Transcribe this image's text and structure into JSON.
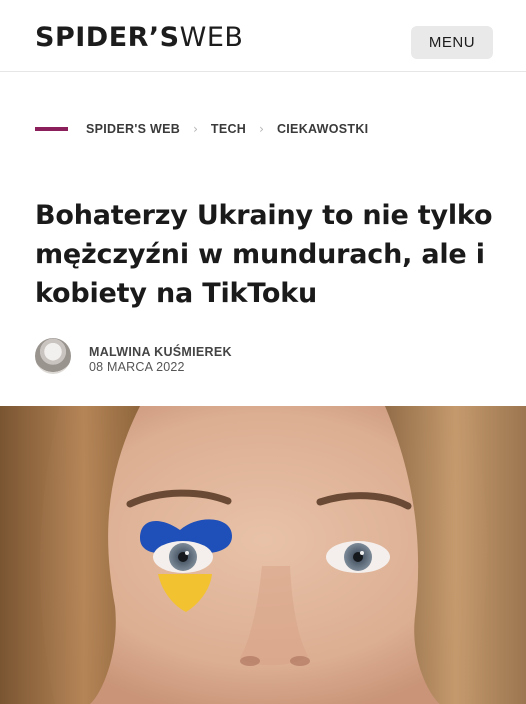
{
  "header": {
    "logo_strong": "SPIDER’S",
    "logo_light": "WEB",
    "menu_label": "MENU"
  },
  "breadcrumb": {
    "items": [
      "SPIDER'S WEB",
      "TECH",
      "CIEKAWOSTKI"
    ],
    "accent_color": "#8a1f5c"
  },
  "article": {
    "title": "Bohaterzy Ukrainy to nie tylko mężczyźni w mundurach, ale i kobiety na TikToku",
    "author": "MALWINA KUŚMIEREK",
    "date": "08 MARCA 2022"
  },
  "hero_image": {
    "flag_colors": [
      "#1f4fb8",
      "#f2c230"
    ]
  }
}
